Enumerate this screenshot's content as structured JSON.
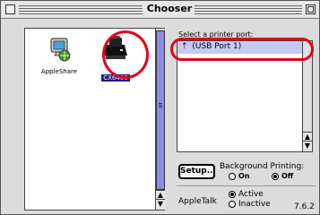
{
  "window": {
    "title": "Chooser"
  },
  "devices": [
    {
      "label": "AppleShare",
      "icon": "appleshare-icon"
    },
    {
      "label": "CX6400",
      "icon": "printer-icon",
      "selected": true
    }
  ],
  "port_panel": {
    "prompt": "Select a printer port:",
    "ports": [
      {
        "label": "(USB Port 1)",
        "icon": "usb-icon",
        "selected": true
      }
    ]
  },
  "setup_button": "Setup...",
  "background_printing": {
    "label": "Background Printing:",
    "options": [
      {
        "label": "On",
        "selected": false
      },
      {
        "label": "Off",
        "selected": true
      }
    ]
  },
  "appletalk": {
    "label": "AppleTalk",
    "options": [
      {
        "label": "Active",
        "selected": true
      },
      {
        "label": "Inactive",
        "selected": false
      }
    ]
  },
  "version": "7.6.2",
  "colors": {
    "highlight_ring": "#e3001b",
    "selection": "#1a1a8c",
    "scroll_thumb": "#8c8ce6"
  }
}
